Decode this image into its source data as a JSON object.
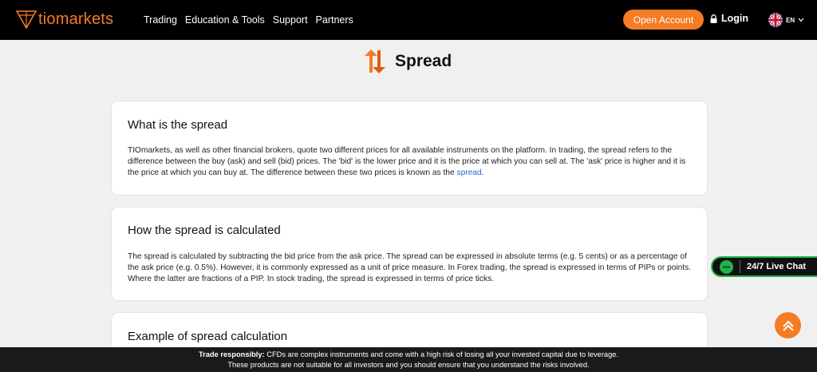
{
  "header": {
    "logo_text": "tiomarkets",
    "nav": [
      "Trading",
      "Education & Tools",
      "Support",
      "Partners"
    ],
    "open_account_label": "Open Account",
    "login_label": "Login",
    "language_code": "EN"
  },
  "page": {
    "title": "Spread"
  },
  "cards": [
    {
      "heading": "What is the spread",
      "body_before_link": "TIOmarkets, as well as other financial brokers, quote two different prices for all available instruments on the platform. In trading, the spread refers to the difference between the buy (ask) and sell (bid) prices. The 'bid' is the lower price and it is the price at which you can sell at. The 'ask' price is higher and it is the price at which you can buy at. The difference between these two prices is known as the ",
      "link_text": "spread",
      "body_after_link": "."
    },
    {
      "heading": "How the spread is calculated",
      "body": "The spread is calculated by subtracting the bid price from the ask price. The spread can be expressed in absolute terms (e.g. 5 cents) or as a percentage of the ask price (e.g. 0.5%). However, it is commonly expressed as a unit of price measure. In Forex trading, the spread is expressed in terms of PIPs or points. Where the latter are fractions of a PIP. In stock trading, the spread is expressed in terms of price ticks."
    },
    {
      "heading": "Example of spread calculation"
    }
  ],
  "live_chat": {
    "label": "24/7 Live Chat"
  },
  "risk_banner": {
    "lead": "Trade responsibly:",
    "line1_rest": " CFDs are complex instruments and come with a high risk of losing all your invested capital due to leverage.",
    "line2": "These products are not suitable for all investors and you should ensure that you understand the risks involved."
  },
  "colors": {
    "brand_orange": "#f47c24",
    "header_bg": "#000000",
    "page_bg": "#f0f0f0",
    "chat_green": "#1fb34a",
    "link_blue": "#1a6fd6"
  },
  "icons": [
    "tio-logo-icon",
    "lock-icon",
    "uk-flag-icon",
    "chevron-down-icon",
    "spread-arrows-icon",
    "chat-bubble-icon",
    "chevron-up-icon"
  ]
}
